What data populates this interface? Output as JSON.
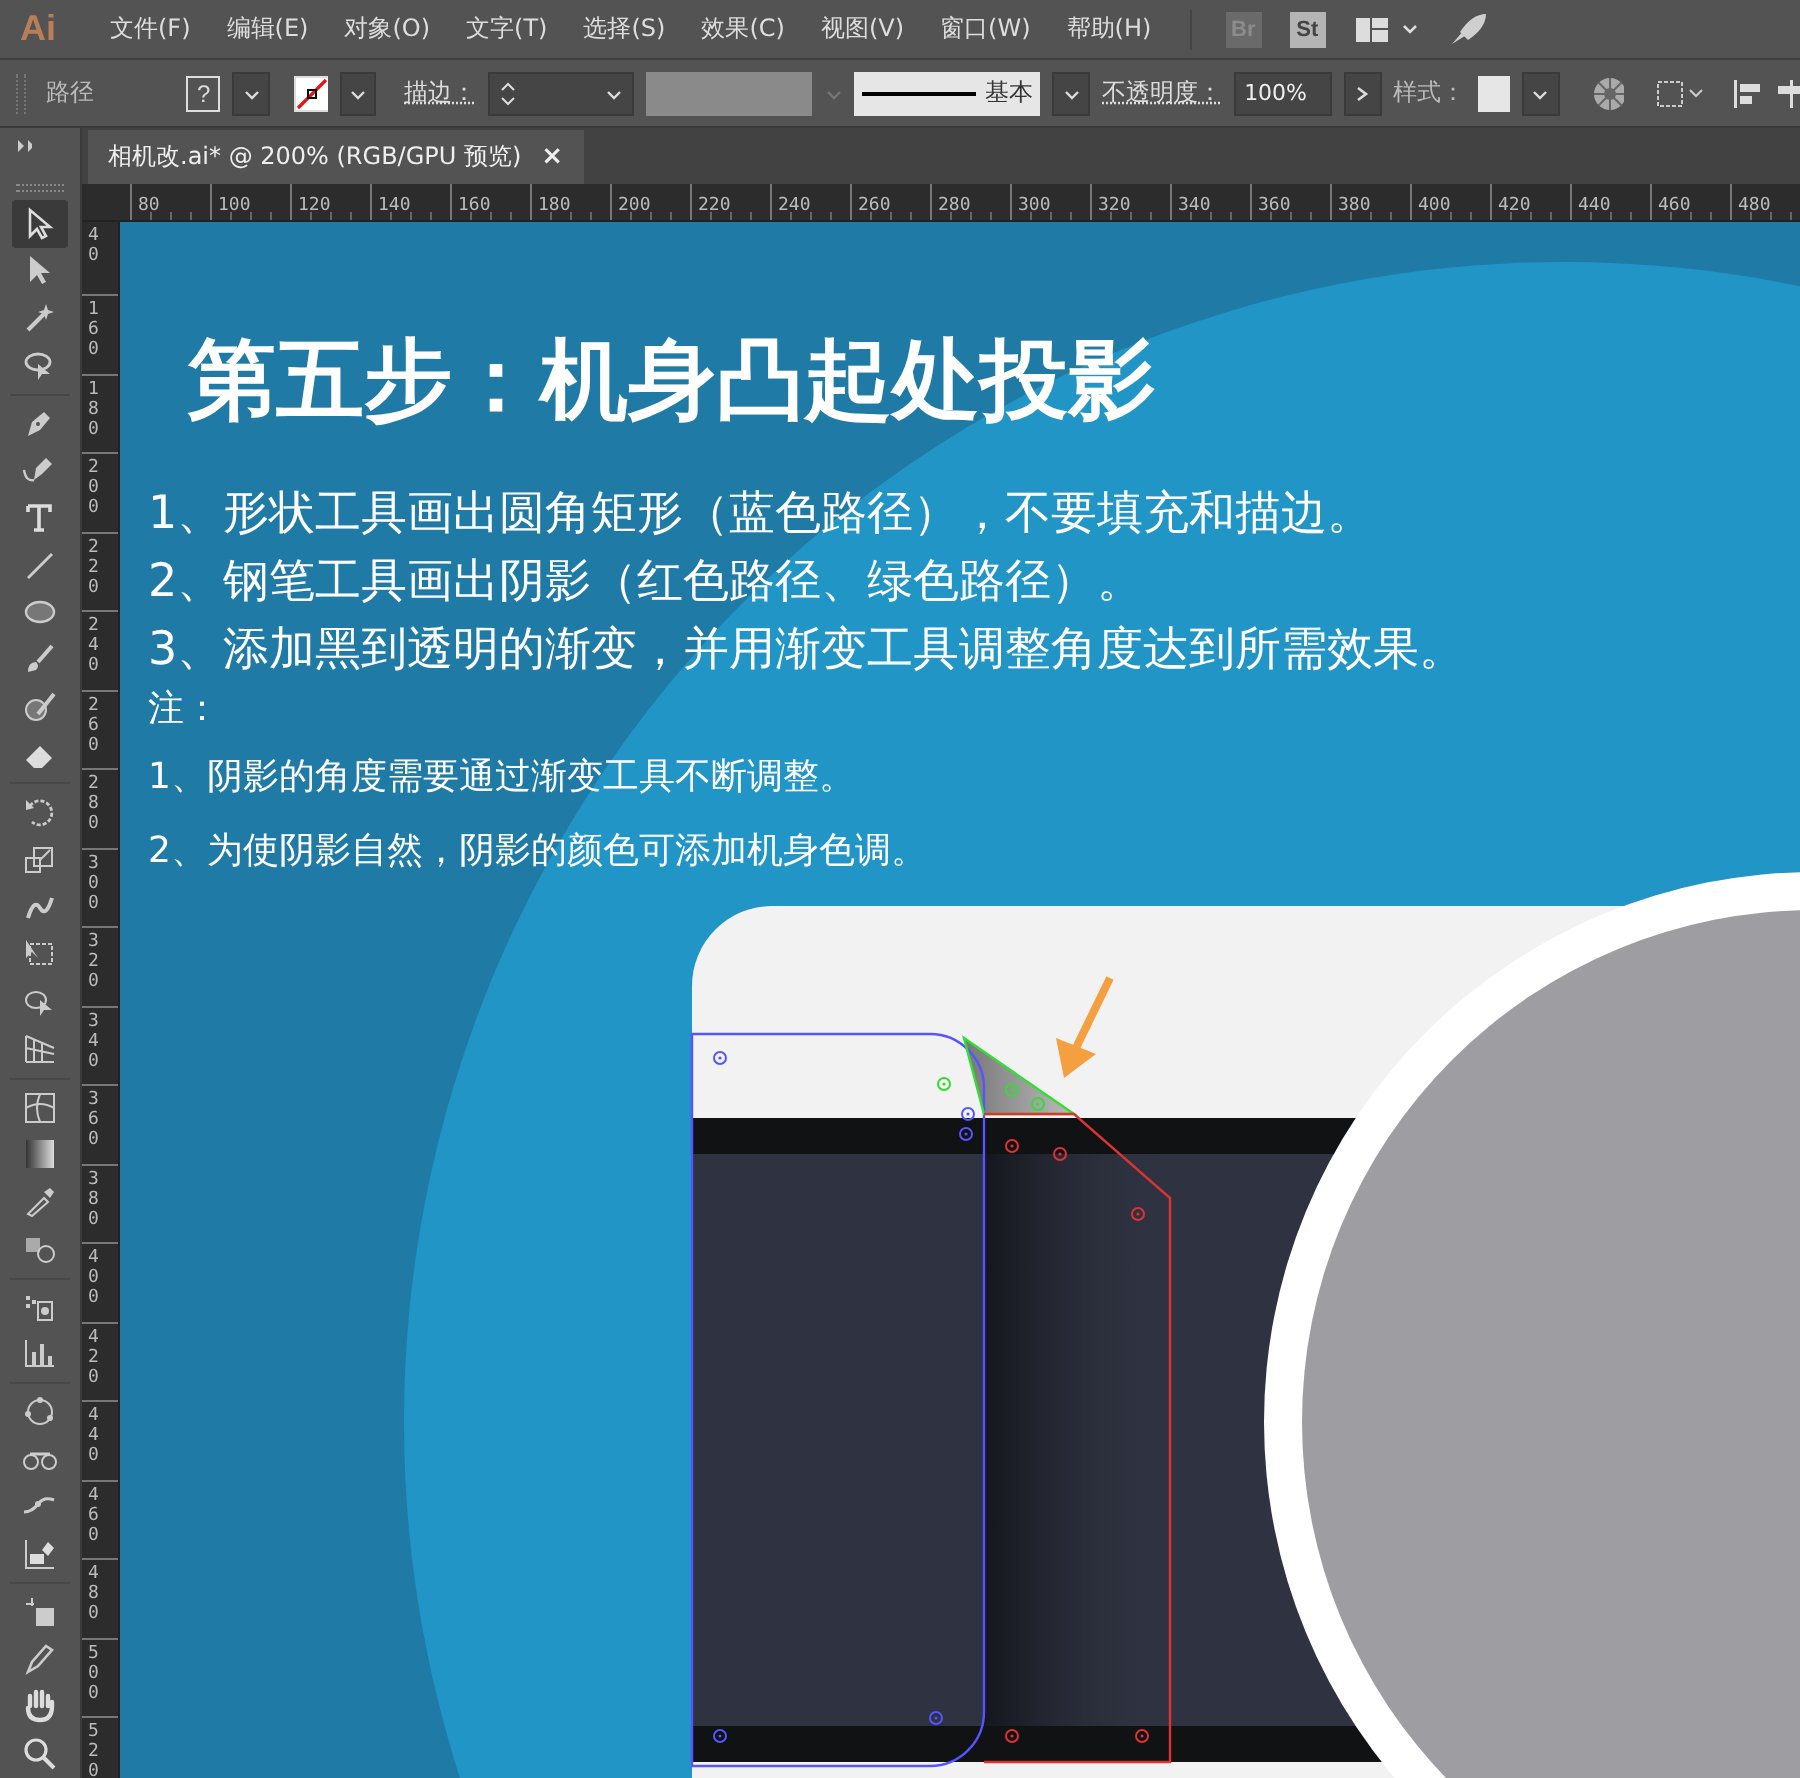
{
  "app": {
    "logo": "Ai",
    "menu": [
      "文件(F)",
      "编辑(E)",
      "对象(O)",
      "文字(T)",
      "选择(S)",
      "效果(C)",
      "视图(V)",
      "窗口(W)",
      "帮助(H)"
    ],
    "bridge": "Br",
    "stock": "St"
  },
  "control_bar": {
    "selection": "路径",
    "fill": "?",
    "stroke_label": "描边：",
    "stroke_style": "基本",
    "opacity_label": "不透明度：",
    "opacity": "100%",
    "style_label": "样式："
  },
  "document_tab": {
    "title": "相机改.ai* @ 200% (RGB/GPU 预览)",
    "close": "×"
  },
  "tools": [
    {
      "kind": "select",
      "selected": true
    },
    {
      "kind": "direct",
      "selected": false
    },
    {
      "kind": "wand",
      "selected": false
    },
    {
      "kind": "lasso",
      "selected": false
    },
    {
      "kind": "sep"
    },
    {
      "kind": "pen",
      "selected": false
    },
    {
      "kind": "curve",
      "selected": false
    },
    {
      "kind": "type",
      "selected": false
    },
    {
      "kind": "line",
      "selected": false
    },
    {
      "kind": "ellipse",
      "selected": false
    },
    {
      "kind": "brush",
      "selected": false
    },
    {
      "kind": "blob",
      "selected": false
    },
    {
      "kind": "eraser",
      "selected": false
    },
    {
      "kind": "sep"
    },
    {
      "kind": "rotate",
      "selected": false
    },
    {
      "kind": "scale",
      "selected": false
    },
    {
      "kind": "warp",
      "selected": false
    },
    {
      "kind": "transform",
      "selected": false
    },
    {
      "kind": "builder",
      "selected": false
    },
    {
      "kind": "grid",
      "selected": false
    },
    {
      "kind": "sep"
    },
    {
      "kind": "mesh",
      "selected": false
    },
    {
      "kind": "gradient",
      "selected": false
    },
    {
      "kind": "dropper",
      "selected": false
    },
    {
      "kind": "blend",
      "selected": false
    },
    {
      "kind": "sep"
    },
    {
      "kind": "spray",
      "selected": false
    },
    {
      "kind": "graph",
      "selected": false
    },
    {
      "kind": "sep"
    },
    {
      "kind": "puppet",
      "selected": false
    },
    {
      "kind": "shaper",
      "selected": false
    },
    {
      "kind": "width",
      "selected": false
    },
    {
      "kind": "artboard",
      "selected": false
    },
    {
      "kind": "sep"
    },
    {
      "kind": "crop",
      "selected": false
    },
    {
      "kind": "knife",
      "selected": false
    },
    {
      "kind": "hand",
      "selected": false
    },
    {
      "kind": "zoom",
      "selected": false
    }
  ],
  "ruler": {
    "horizontal": [
      "80",
      "100",
      "120",
      "140",
      "160",
      "180",
      "200",
      "220",
      "240",
      "260",
      "280",
      "300",
      "320",
      "340",
      "360",
      "380",
      "400",
      "420",
      "440",
      "460",
      "480"
    ],
    "vertical": [
      "40",
      "160",
      "180",
      "200",
      "220",
      "240",
      "260",
      "280",
      "300",
      "320",
      "340",
      "360",
      "380",
      "400",
      "420",
      "440",
      "460",
      "480",
      "500",
      "520"
    ]
  },
  "artboard": {
    "title": "第五步：机身凸起处投影",
    "steps": [
      "1、形状工具画出圆角矩形（蓝色路径），不要填充和描边。",
      "2、钢笔工具画出阴影（红色路径、绿色路径）。",
      "3、添加黑到透明的渐变，并用渐变工具调整角度达到所需效果。"
    ],
    "note_label": "注：",
    "notes": [
      "1、阴影的角度需要通过渐变工具不断调整。",
      "2、为使阴影自然，阴影的颜色可添加机身色调。"
    ]
  }
}
